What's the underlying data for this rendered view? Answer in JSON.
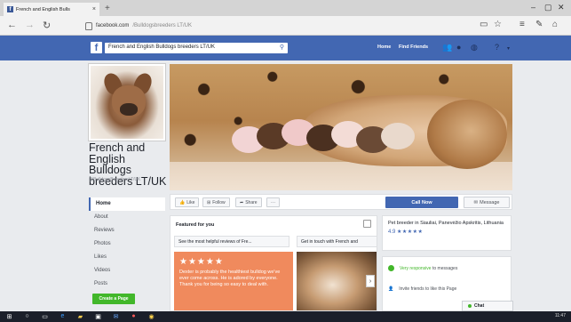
{
  "browser": {
    "tab_title": "French and English Bulls",
    "tab_close": "×",
    "new_tab": "+",
    "url_host": "facebook.com",
    "url_path": "/Bulldogsbreeders LT/UK"
  },
  "fb": {
    "logo": "f",
    "search_value": "French and English Bulldogs breeders LT/UK",
    "nav_home": "Home",
    "nav_find_friends": "Find Friends"
  },
  "page": {
    "name": "French and English Bulldogs breeders LT/UK",
    "handle": "@BulldogsBreedersLT/UK",
    "nav": [
      "Home",
      "About",
      "Reviews",
      "Photos",
      "Likes",
      "Videos",
      "Posts"
    ],
    "create_page": "Create a Page"
  },
  "actions": {
    "like": "Like",
    "follow": "Follow",
    "share": "Share",
    "more": "···",
    "call_now": "Call Now",
    "message": "Message"
  },
  "featured": {
    "title": "Featured for you",
    "tab1": "See the most helpful reviews of Fre...",
    "tab2": "Get in touch with French and",
    "stars": "★★★★★",
    "review": "Dexter is probably the healthiest bulldog we've ever come across. He is adored by everyone. Thank you for being so easy to deal with."
  },
  "about": {
    "text": "Pet breeder in Siauliai, Panevėžio Apskritis, Lithuania",
    "rating": "4.9",
    "stars": "★★★★★"
  },
  "responses": {
    "responsive_label": "Very responsive",
    "responsive_suffix": "to messages",
    "invite": "Invite friends to like this Page"
  },
  "chat": {
    "label": "Chat"
  },
  "taskbar": {
    "time": "11:47"
  }
}
